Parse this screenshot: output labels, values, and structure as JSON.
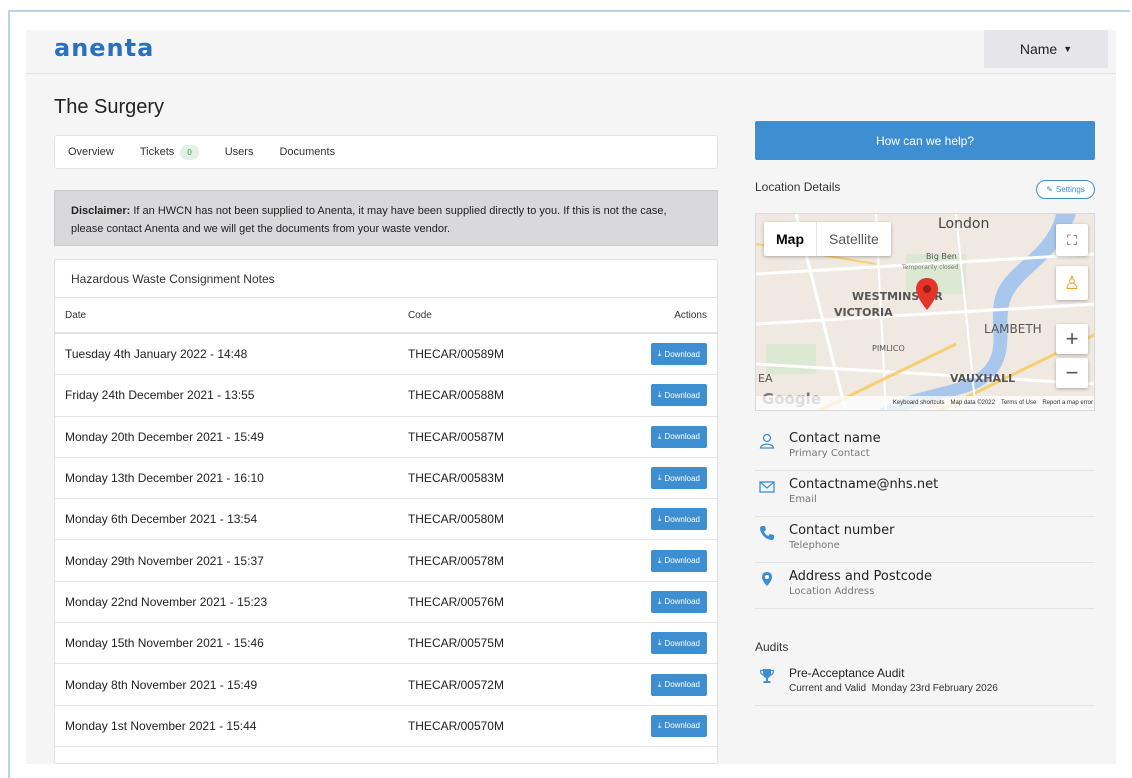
{
  "header": {
    "logo": "anenta",
    "user_menu": "Name"
  },
  "site": {
    "title": "The Surgery"
  },
  "tabs": [
    {
      "label": "Overview"
    },
    {
      "label": "Tickets",
      "badge": "0"
    },
    {
      "label": "Users"
    },
    {
      "label": "Documents"
    }
  ],
  "disclaimer": {
    "label": "Disclaimer:",
    "text": " If an HWCN has not been supplied to Anenta, it may have been supplied directly to you. If this is not the case, please contact Anenta and we will get the documents from your waste vendor."
  },
  "notes": {
    "title": "Hazardous Waste Consignment Notes",
    "columns": [
      "Date",
      "Code",
      "Actions"
    ],
    "download_label": "Download",
    "rows": [
      {
        "date": "Tuesday 4th January 2022 - 14:48",
        "code": "THECAR/00589M"
      },
      {
        "date": "Friday 24th December 2021 - 13:55",
        "code": "THECAR/00588M"
      },
      {
        "date": "Monday 20th December 2021 - 15:49",
        "code": "THECAR/00587M"
      },
      {
        "date": "Monday 13th December 2021 - 16:10",
        "code": "THECAR/00583M"
      },
      {
        "date": "Monday 6th December 2021 - 13:54",
        "code": "THECAR/00580M"
      },
      {
        "date": "Monday 29th November 2021 - 15:37",
        "code": "THECAR/00578M"
      },
      {
        "date": "Monday 22nd November 2021 - 15:23",
        "code": "THECAR/00576M"
      },
      {
        "date": "Monday 15th November 2021 - 15:46",
        "code": "THECAR/00575M"
      },
      {
        "date": "Monday 8th November 2021 - 15:49",
        "code": "THECAR/00572M"
      },
      {
        "date": "Monday 1st November 2021 - 15:44",
        "code": "THECAR/00570M"
      }
    ]
  },
  "help": {
    "label": "How can we help?"
  },
  "location": {
    "label": "Location Details",
    "settings_label": "Settings"
  },
  "map": {
    "map_btn": "Map",
    "satellite_btn": "Satellite",
    "places": {
      "london": "London",
      "big_ben": "Big Ben",
      "big_ben_sub": "Temporarily closed",
      "westminster": "WESTMINSTER",
      "victoria": "VICTORIA",
      "lambeth": "LAMBETH",
      "pimlico": "PIMLICO",
      "vauxhall": "VAUXHALL",
      "ea": "EA"
    },
    "google": "Google",
    "footer": [
      "Keyboard shortcuts",
      "Map data ©2022",
      "Terms of Use",
      "Report a map error"
    ]
  },
  "contacts": [
    {
      "name": "Contact name",
      "sub": "Primary Contact",
      "icon": "user-icon"
    },
    {
      "name": "Contactname@nhs.net",
      "sub": "Email",
      "icon": "envelope-icon"
    },
    {
      "name": "Contact number",
      "sub": "Telephone",
      "icon": "phone-icon"
    },
    {
      "name": "Address and Postcode",
      "sub": "Location Address",
      "icon": "map-pin-icon"
    }
  ],
  "audits": {
    "label": "Audits",
    "items": [
      {
        "name": "Pre-Acceptance Audit",
        "status": "Current and Valid",
        "date": "Monday 23rd February 2026",
        "icon": "trophy-icon"
      }
    ]
  },
  "colors": {
    "accent": "#3d8fd1",
    "logo": "#2a6fc0",
    "badge_text": "#3a9a45"
  }
}
